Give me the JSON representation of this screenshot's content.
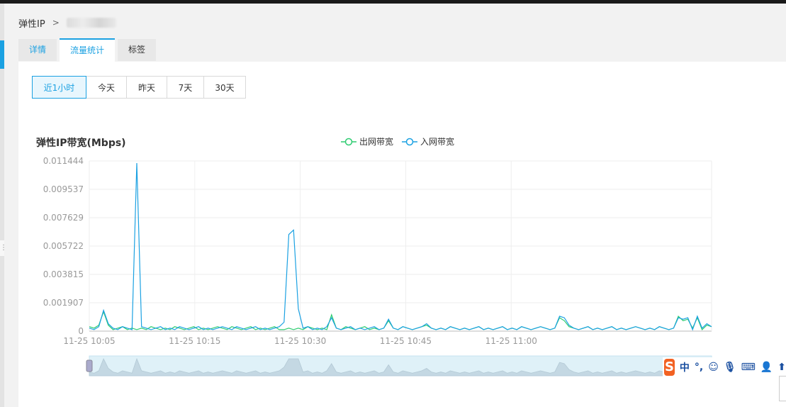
{
  "breadcrumb": {
    "root": "弹性IP",
    "separator": ">"
  },
  "tabs": [
    {
      "label": "详情",
      "active": false
    },
    {
      "label": "流量统计",
      "active": true
    },
    {
      "label": "标签",
      "active": false
    }
  ],
  "range_buttons": [
    {
      "label": "近1小时",
      "active": true
    },
    {
      "label": "今天",
      "active": false
    },
    {
      "label": "昨天",
      "active": false
    },
    {
      "label": "7天",
      "active": false
    },
    {
      "label": "30天",
      "active": false
    }
  ],
  "colors": {
    "accent": "#1ba1e2",
    "outbound": "#2ecc71",
    "inbound": "#1ba1e2",
    "zoom_fill": "#dff1f8"
  },
  "chart_data": {
    "type": "line",
    "title": "弹性IP带宽(Mbps)",
    "legend_position": "top-center",
    "grid": true,
    "ylim": [
      0,
      0.011444
    ],
    "y_ticks": [
      "0.011444",
      "0.009537",
      "0.007629",
      "0.005722",
      "0.003815",
      "0.001907",
      "0"
    ],
    "x_ticks": [
      "11-25 10:05",
      "11-25 10:15",
      "11-25 10:30",
      "11-25 10:45",
      "11-25 11:00"
    ],
    "x_tick_minutes": [
      5,
      15,
      25,
      35,
      45
    ],
    "x_range_minutes": [
      5,
      64
    ],
    "series": [
      {
        "name": "出网带宽",
        "color": "#2ecc71",
        "values": [
          0.0003,
          0.0002,
          0.0004,
          0.0013,
          0.0004,
          0.0001,
          0.0002,
          0.0003,
          0.0001,
          0.0002,
          0.0001,
          0.0002,
          0.0001,
          0.0003,
          0.0002,
          0.0001,
          0.0002,
          0.0001,
          0.0003,
          0.0002,
          0.0001,
          0.0002,
          0.0003,
          0.0001,
          0.0002,
          0.0001,
          0.0002,
          0.0003,
          0.0002,
          0.0001,
          0.0003,
          0.0002,
          0.0001,
          0.0002,
          0.0003,
          0.0001,
          0.0002,
          0.0001,
          0.0002,
          0.0003,
          0.0001,
          0.0001,
          0.0002,
          0.0001,
          0.0002,
          0.0001,
          0.0003,
          0.0002,
          0.0001,
          0.0002,
          0.0001,
          0.0011,
          0.0002,
          0.0001,
          0.0003,
          0.0002,
          0.0001,
          0.0002,
          0.0003,
          0.0001,
          0.0002,
          0.0001,
          0.0002,
          0.0007,
          0.0002,
          0.0001,
          0.0003,
          0.0002,
          0.0001,
          0.0002,
          0.0003,
          0.0004,
          0.0002,
          0.0001,
          0.0002,
          0.0001,
          0.0003,
          0.0002,
          0.0001,
          0.0002,
          0.0001,
          0.0002,
          0.0003,
          0.0001,
          0.0002,
          0.0001,
          0.0002,
          0.0003,
          0.0001,
          0.0002,
          0.0001,
          0.0003,
          0.0002,
          0.0001,
          0.0002,
          0.0003,
          0.0002,
          0.0001,
          0.0002,
          0.0009,
          0.0007,
          0.0003,
          0.0002,
          0.0001,
          0.0002,
          0.0003,
          0.0001,
          0.0002,
          0.0001,
          0.0002,
          0.0003,
          0.0001,
          0.0002,
          0.0001,
          0.0002,
          0.0003,
          0.0002,
          0.0001,
          0.0002,
          0.0001,
          0.0003,
          0.0002,
          0.0001,
          0.0002,
          0.001,
          0.0007,
          0.0008,
          0.0002,
          0.0009,
          0.0001,
          0.0004,
          0.0003
        ]
      },
      {
        "name": "入网带宽",
        "color": "#1ba1e2",
        "values": [
          0.0002,
          0.0001,
          0.0003,
          0.0014,
          0.0005,
          0.0002,
          0.0001,
          0.0003,
          0.0002,
          0.0001,
          0.0113,
          0.0003,
          0.0002,
          0.0001,
          0.0002,
          0.0003,
          0.0001,
          0.0002,
          0.0001,
          0.0003,
          0.0002,
          0.0001,
          0.0002,
          0.0003,
          0.0001,
          0.0002,
          0.0001,
          0.0002,
          0.0003,
          0.0002,
          0.0001,
          0.0003,
          0.0002,
          0.0001,
          0.0002,
          0.0003,
          0.0001,
          0.0002,
          0.0001,
          0.0002,
          0.0003,
          0.0006,
          0.0065,
          0.0068,
          0.0015,
          0.0002,
          0.0003,
          0.0001,
          0.0002,
          0.0001,
          0.0003,
          0.0009,
          0.0002,
          0.0001,
          0.0002,
          0.0003,
          0.0001,
          0.0002,
          0.0001,
          0.0002,
          0.0003,
          0.0001,
          0.0002,
          0.0008,
          0.0002,
          0.0001,
          0.0003,
          0.0002,
          0.0001,
          0.0002,
          0.0003,
          0.0005,
          0.0002,
          0.0001,
          0.0002,
          0.0001,
          0.0003,
          0.0002,
          0.0001,
          0.0002,
          0.0001,
          0.0002,
          0.0003,
          0.0001,
          0.0002,
          0.0001,
          0.0002,
          0.0003,
          0.0001,
          0.0002,
          0.0001,
          0.0003,
          0.0002,
          0.0001,
          0.0002,
          0.0003,
          0.0002,
          0.0001,
          0.0002,
          0.001,
          0.0009,
          0.0004,
          0.0002,
          0.0001,
          0.0002,
          0.0003,
          0.0001,
          0.0002,
          0.0001,
          0.0002,
          0.0003,
          0.0001,
          0.0002,
          0.0001,
          0.0002,
          0.0003,
          0.0002,
          0.0001,
          0.0002,
          0.0001,
          0.0003,
          0.0002,
          0.0001,
          0.0002,
          0.0009,
          0.0008,
          0.0009,
          0.0001,
          0.001,
          0.0002,
          0.0005,
          0.0003
        ]
      }
    ]
  },
  "ime": {
    "lang": "中",
    "punct": "°,"
  }
}
